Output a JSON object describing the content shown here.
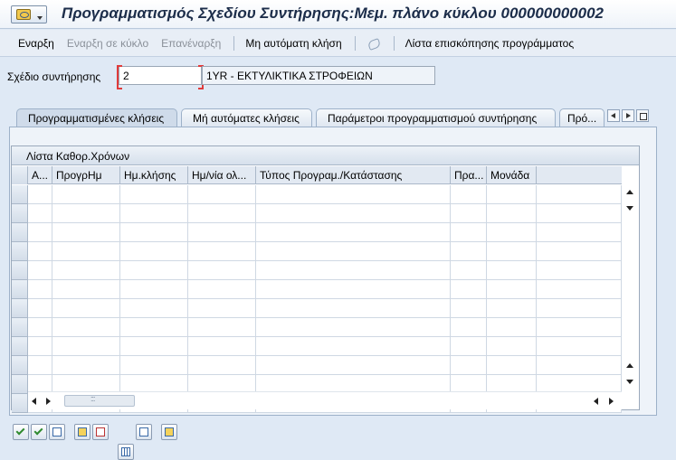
{
  "window": {
    "title": "Προγραμματισμός Σχεδίου Συντήρησης:Μεμ. πλάνο κύκλου 000000000002",
    "system_menu_icon": "sap-system-menu-icon"
  },
  "toolbar": {
    "start": "Εναρξη",
    "start_in_cycle": "Εναρξη σε κύκλο",
    "restart": "Επανέναρξη",
    "manual_call": "Μη αυτόματη κλήση",
    "schedule_overview": "Λίστα επισκόπησης προγράμματος"
  },
  "plan": {
    "label": "Σχέδιο συντήρησης",
    "value": "2",
    "description": "1YR - ΕΚΤΥΛΙΚΤΙΚΑ ΣΤΡΟΦΕΙΩΝ"
  },
  "tabs": [
    {
      "label": "Προγραμματισμένες κλήσεις",
      "active": true
    },
    {
      "label": "Μή αυτόματες κλήσεις",
      "active": false
    },
    {
      "label": "Παράμετροι προγραμματισμού συντήρησης",
      "active": false
    },
    {
      "label": "Πρό...",
      "active": false
    }
  ],
  "table": {
    "title": "Λίστα Καθορ.Χρόνων",
    "columns": [
      "Α...",
      "ΠρογρΗμ",
      "Ημ.κλήσης",
      "Ημ/νία ολ...",
      "Τύπος Προγραμ./Κατάστασης",
      "Πρα...",
      "Μονάδα"
    ],
    "rows": []
  }
}
